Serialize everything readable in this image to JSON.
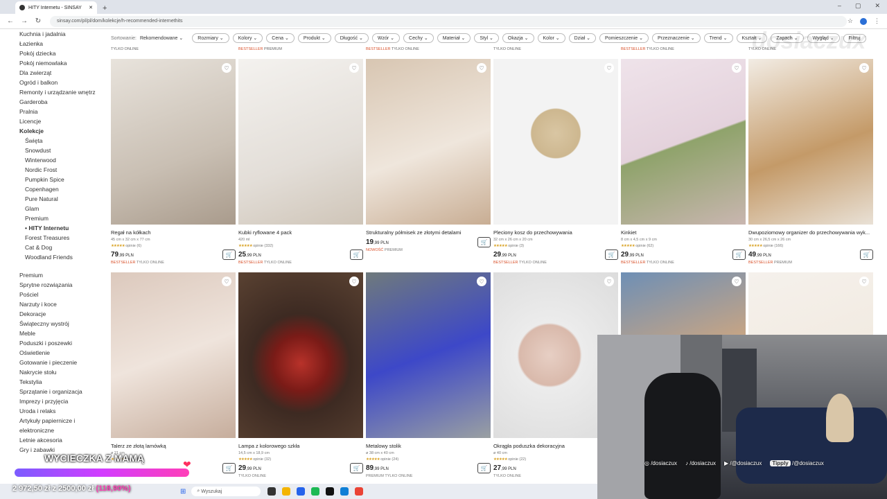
{
  "browser": {
    "tab_title": "HITY Internetu - SINSAY",
    "url": "sinsay.com/pl/pl/dom/kolekcje/h-recommended-internethits"
  },
  "sidebar": {
    "items": [
      {
        "label": "Kuchnia i jadalnia",
        "type": "cat"
      },
      {
        "label": "Łazienka",
        "type": "cat"
      },
      {
        "label": "Pokój dziecka",
        "type": "cat"
      },
      {
        "label": "Pokój niemowlaka",
        "type": "cat"
      },
      {
        "label": "Dla zwierząt",
        "type": "cat"
      },
      {
        "label": "Ogród i balkon",
        "type": "cat"
      },
      {
        "label": "Remonty i urządzanie wnętrz",
        "type": "cat"
      },
      {
        "label": "Garderoba",
        "type": "cat"
      },
      {
        "label": "Pralnia",
        "type": "cat"
      },
      {
        "label": "Licencje",
        "type": "cat"
      },
      {
        "label": "Kolekcje",
        "type": "bold"
      },
      {
        "label": "Święta",
        "type": "sub"
      },
      {
        "label": "Snowdust",
        "type": "sub"
      },
      {
        "label": "Winterwood",
        "type": "sub"
      },
      {
        "label": "Nordic Frost",
        "type": "sub"
      },
      {
        "label": "Pumpkin Spice",
        "type": "sub"
      },
      {
        "label": "Copenhagen",
        "type": "sub"
      },
      {
        "label": "Pure Natural",
        "type": "sub"
      },
      {
        "label": "Glam",
        "type": "sub"
      },
      {
        "label": "Premium",
        "type": "sub"
      },
      {
        "label": "• HITY Internetu",
        "type": "subbold"
      },
      {
        "label": "Forest Treasures",
        "type": "sub"
      },
      {
        "label": "Cat & Dog",
        "type": "sub"
      },
      {
        "label": "Woodland Friends",
        "type": "sub"
      },
      {
        "label": "Premium",
        "type": "gap"
      },
      {
        "label": "Sprytne rozwiązania",
        "type": "cat"
      },
      {
        "label": "Pościel",
        "type": "cat"
      },
      {
        "label": "Narzuty i koce",
        "type": "cat"
      },
      {
        "label": "Dekoracje",
        "type": "cat"
      },
      {
        "label": "Świąteczny wystrój",
        "type": "cat"
      },
      {
        "label": "Meble",
        "type": "cat"
      },
      {
        "label": "Poduszki i poszewki",
        "type": "cat"
      },
      {
        "label": "Oświetlenie",
        "type": "cat"
      },
      {
        "label": "Gotowanie i pieczenie",
        "type": "cat"
      },
      {
        "label": "Nakrycie stołu",
        "type": "cat"
      },
      {
        "label": "Tekstylia",
        "type": "cat"
      },
      {
        "label": "Sprzątanie i organizacja",
        "type": "cat"
      },
      {
        "label": "Imprezy i przyjęcia",
        "type": "cat"
      },
      {
        "label": "Uroda i relaks",
        "type": "cat"
      },
      {
        "label": "Artykuły papiernicze i",
        "type": "cat"
      },
      {
        "label": "elektroniczne",
        "type": "cat"
      },
      {
        "label": "Letnie akcesoria",
        "type": "cat"
      },
      {
        "label": "Gry i zabawki",
        "type": "cat"
      }
    ]
  },
  "filters": {
    "sort_label": "Sortowanie:",
    "sort_value": "Rekomendowane",
    "chips": [
      "Rozmiary",
      "Kolory",
      "Cena",
      "Produkt",
      "Długość",
      "Wzór",
      "Cechy",
      "Materiał",
      "Styl",
      "Okazja",
      "Kolor",
      "Dział",
      "Pomieszczenie",
      "Przeznaczenie",
      "Trend",
      "Kształt",
      "Zapach",
      "Wygląd"
    ],
    "filter_button": "Filtruj"
  },
  "prev_row_badges": [
    {
      "hl": "",
      "txt": "TYLKO ONLINE"
    },
    {
      "hl": "BESTSELLER",
      "txt": "PREMIUM"
    },
    {
      "hl": "BESTSELLER",
      "txt": "TYLKO ONLINE"
    },
    {
      "hl": "",
      "txt": "TYLKO ONLINE"
    },
    {
      "hl": "BESTSELLER",
      "txt": "TYLKO ONLINE"
    },
    {
      "hl": "",
      "txt": "TYLKO ONLINE"
    }
  ],
  "products": [
    {
      "name": "Regał na kółkach",
      "dims": "45 cm x 32 cm x 77 cm",
      "rating": "opinie (6)",
      "price_int": "79",
      "price_dec": ",99 PLN",
      "hl": "BESTSELLER",
      "badge": "TYLKO ONLINE",
      "img": "linear-gradient(160deg,#e8e3dc,#c9bfb3 60%,#a99b8c)"
    },
    {
      "name": "Kubki ryflowane 4 pack",
      "dims": "420 ml",
      "rating": "opinie (332)",
      "price_int": "25",
      "price_dec": ",99 PLN",
      "hl": "BESTSELLER",
      "badge": "TYLKO ONLINE",
      "img": "linear-gradient(160deg,#f4f2ef,#e3ded8 60%,#cfc5b8)"
    },
    {
      "name": "Strukturalny półmisek ze złotymi detalami",
      "dims": "",
      "rating": "",
      "price_int": "19",
      "price_dec": ",99 PLN",
      "hl": "NOWOŚĆ",
      "badge": "PREMIUM",
      "img": "linear-gradient(160deg,#d8c6b2,#efe6dc 55%,#c8ad93)"
    },
    {
      "name": "Pleciony kosz do przechowywania",
      "dims": "32 cm x 26 cm x 20 cm",
      "rating": "opinie (3)",
      "price_int": "29",
      "price_dec": ",99 PLN",
      "hl": "BESTSELLER",
      "badge": "TYLKO ONLINE",
      "img": "radial-gradient(circle at 50% 45%,#d9c6a3 0,#cdb78f 22%,#f3f3f3 23%)"
    },
    {
      "name": "Kinkiet",
      "dims": "8 cm x 4,5 cm x 9 cm",
      "rating": "opinie (62)",
      "price_int": "29",
      "price_dec": ",99 PLN",
      "hl": "BESTSELLER",
      "badge": "TYLKO ONLINE",
      "img": "linear-gradient(160deg,#efe3ea,#e4d2dc 50%,#8fa36b 51%,#c9b6b0)"
    },
    {
      "name": "Dwupoziomowy organizer do przechowywania wyk...",
      "dims": "30 cm x 26,5 cm x 26 cm",
      "rating": "opinie (166)",
      "price_int": "49",
      "price_dec": ",99 PLN",
      "hl": "BESTSELLER",
      "badge": "PREMIUM",
      "img": "linear-gradient(160deg,#f2ece4,#c49a68 55%,#e9e1d6)"
    },
    {
      "name": "Talerz ze złotą lamówką",
      "dims": "ø 21 cm",
      "rating": "opinie (62)",
      "price_int": "",
      "price_dec": "",
      "hl": "",
      "badge": "",
      "img": "linear-gradient(160deg,#dcc9bd,#efe4dc 50%,#c6ad9c)"
    },
    {
      "name": "Lampa z kolorowego szkła",
      "dims": "14,5 cm x 18,9 cm",
      "rating": "opinie (32)",
      "price_int": "29",
      "price_dec": ",99 PLN",
      "hl": "",
      "badge": "TYLKO ONLINE",
      "img": "radial-gradient(circle at 50% 55%,#b8322a 0,#7a1b17 25%,#3d2a22 45%,#5a4232)"
    },
    {
      "name": "Metalowy stolik",
      "dims": "ø 38 cm x 40 cm",
      "rating": "opinie (24)",
      "price_int": "89",
      "price_dec": ",99 PLN",
      "hl": "",
      "badge": "PREMIUM  TYLKO ONLINE",
      "img": "linear-gradient(160deg,#6f7a7c,#3d48c8 50%,#9aa0a2)"
    },
    {
      "name": "Okrągła poduszka dekoracyjna",
      "dims": "ø 40 cm",
      "rating": "opinie (22)",
      "price_int": "27",
      "price_dec": ",99 PLN",
      "hl": "",
      "badge": "TYLKO ONLINE",
      "img": "radial-gradient(circle at 45% 50%,#e7cfc4 0,#d9b9ab 28%,#ececec 30%,#dcdcdc)"
    },
    {
      "name": "",
      "dims": "",
      "rating": "",
      "price_int": "",
      "price_dec": "",
      "hl": "",
      "badge": "",
      "img": "linear-gradient(160deg,#6e8fb5,#c4a486 50%,#e8dccd)"
    },
    {
      "name": "",
      "dims": "",
      "rating": "",
      "price_int": "",
      "price_dec": "",
      "hl": "",
      "badge": "",
      "img": "linear-gradient(160deg,#f5f1ec,#efe5d8)"
    }
  ],
  "stream": {
    "goal_title": "WYCIECZKA Z MAMĄ",
    "goal_amount": "2 972,50 zł z 2500,00 zł",
    "goal_percent": "(118,90%)",
    "goal_fraction": 1.0,
    "socials": [
      "/dosiaczux",
      "/dosiaczux",
      "/@dosiaczux",
      "/@dosiaczux"
    ],
    "tipply": "Tipply",
    "watermark": "dosiaczux"
  },
  "taskbar": {
    "search_placeholder": "Wyszukaj",
    "app_colors": [
      "#333",
      "#f4b400",
      "#2563eb",
      "#1db954",
      "#111",
      "#0f7fd6",
      "#ea4335"
    ]
  }
}
